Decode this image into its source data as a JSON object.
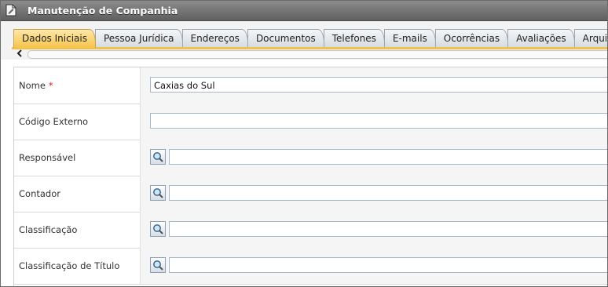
{
  "window": {
    "title": "Manutenção de Companhia"
  },
  "tabs": [
    {
      "label": "Dados Iniciais",
      "active": true
    },
    {
      "label": "Pessoa Jurídica",
      "active": false
    },
    {
      "label": "Endereços",
      "active": false
    },
    {
      "label": "Documentos",
      "active": false
    },
    {
      "label": "Telefones",
      "active": false
    },
    {
      "label": "E-mails",
      "active": false
    },
    {
      "label": "Ocorrências",
      "active": false
    },
    {
      "label": "Avaliações",
      "active": false
    },
    {
      "label": "Arquivos",
      "active": false
    }
  ],
  "form": {
    "nome": {
      "label": "Nome",
      "required_mark": "*",
      "value": "Caxias do Sul"
    },
    "codigo_externo": {
      "label": "Código Externo",
      "value": ""
    },
    "responsavel": {
      "label": "Responsável",
      "value": ""
    },
    "contador": {
      "label": "Contador",
      "value": ""
    },
    "classificacao": {
      "label": "Classificação",
      "value": ""
    },
    "classificacao_titulo": {
      "label": "Classificação de Título",
      "value": ""
    }
  },
  "icons": {
    "title": "document-edit-icon",
    "lookup": "magnifier-icon",
    "scroll_left": "arrow-left-icon"
  },
  "colors": {
    "titlebar": "#6e6e6e",
    "active_tab": "#f6c34a",
    "required": "#e02020"
  }
}
